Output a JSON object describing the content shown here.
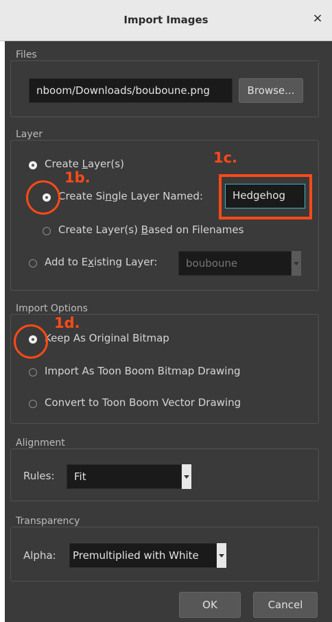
{
  "window": {
    "title": "Import Images",
    "close_glyph": "×"
  },
  "files": {
    "group_title": "Files",
    "path_value": "nboom/Downloads/bouboune.png",
    "browse_label": "Browse..."
  },
  "layer": {
    "group_title": "Layer",
    "create_layers": {
      "pre": "Create ",
      "key": "L",
      "post": "ayer(s)",
      "checked": true
    },
    "single_layer": {
      "pre": "Create Si",
      "key": "n",
      "post": "gle Layer Named:",
      "checked": true,
      "name_value": "Hedgehog"
    },
    "based_on_filenames": {
      "pre": "Create Layer(s) ",
      "key": "B",
      "post": "ased on Filenames",
      "checked": false
    },
    "add_existing": {
      "pre": "Add to E",
      "key": "x",
      "post": "isting Layer:",
      "checked": false,
      "layer_value": "bouboune"
    }
  },
  "import_options": {
    "group_title": "Import Options",
    "keep_original": {
      "label": "Keep As Original Bitmap",
      "checked": true
    },
    "toon_bitmap": {
      "label": "Import As Toon Boom Bitmap Drawing",
      "checked": false
    },
    "toon_vector": {
      "label": "Convert to Toon Boom Vector Drawing",
      "checked": false
    }
  },
  "alignment": {
    "group_title": "Alignment",
    "rules_label": "Rules:",
    "rules_value": "Fit"
  },
  "transparency": {
    "group_title": "Transparency",
    "alpha_label": "Alpha:",
    "alpha_value": "Premultiplied with White"
  },
  "buttons": {
    "ok": "OK",
    "cancel": "Cancel"
  },
  "annotations": {
    "step_1b": "1b.",
    "step_1c": "1c.",
    "step_1d": "1d.",
    "color": "#ff4a17"
  },
  "colors": {
    "dialog_bg": "#3a3a3a",
    "field_bg": "#1a1a1a",
    "accent_focus": "#3fb6c8"
  }
}
